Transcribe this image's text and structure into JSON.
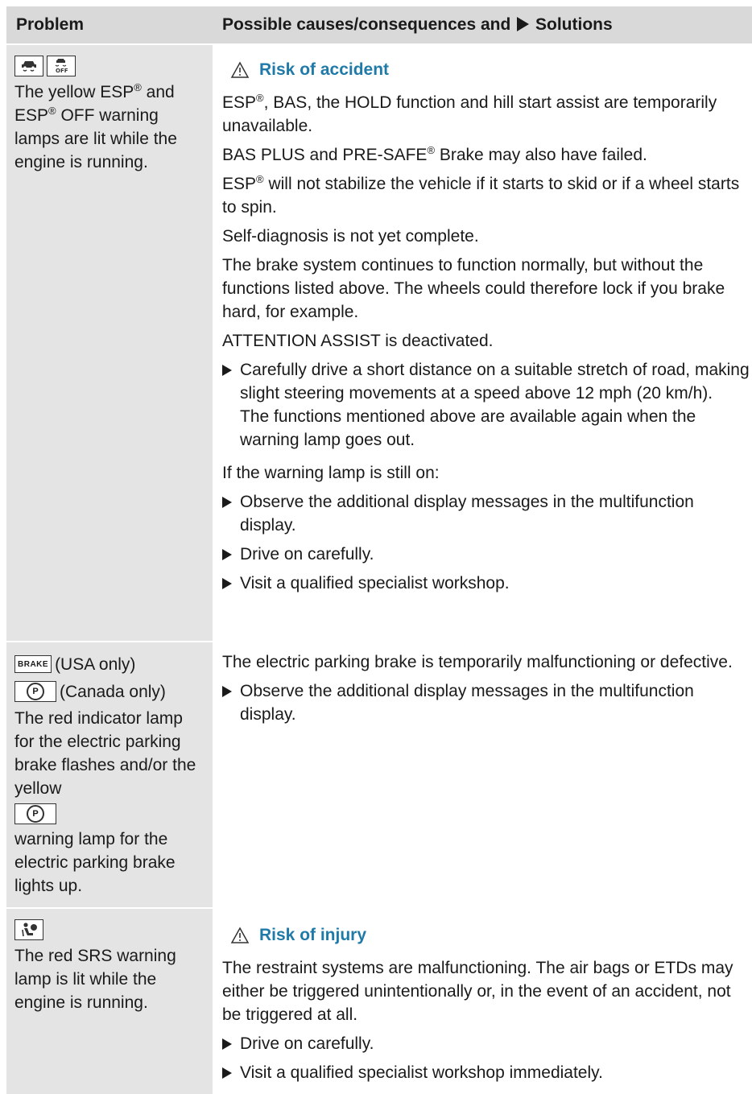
{
  "header": {
    "problem": "Problem",
    "solutions_pre": "Possible causes/consequences and",
    "solutions_post": "Solutions"
  },
  "rows": [
    {
      "icons": [
        "esp-warning-icon",
        "esp-off-warning-icon"
      ],
      "problem_text_a": "The yellow ESP",
      "problem_text_b": " and ESP",
      "problem_text_c": " OFF warning lamps are lit while the engine is running.",
      "reg": "®",
      "warning_title": "Risk of accident",
      "p1_a": "ESP",
      "p1_b": ", BAS, the HOLD function and hill start assist are temporarily unavailable.",
      "p2_a": "BAS PLUS and PRE-SAFE",
      "p2_b": " Brake may also have failed.",
      "p3_a": "ESP",
      "p3_b": " will not stabilize the vehicle if it starts to skid or if a wheel starts to spin.",
      "p4": "Self-diagnosis is not yet complete.",
      "p5": "The brake system continues to function normally, but without the functions listed above. The wheels could therefore lock if you brake hard, for example.",
      "p6": "ATTENTION ASSIST is deactivated.",
      "b1": "Carefully drive a short distance on a suitable stretch of road, making slight steering movements at a speed above 12 mph (20 km/h).",
      "b1_note": "The functions mentioned above are available again when the warning lamp goes out.",
      "p7": "If the warning lamp is still on:",
      "b2": "Observe the additional display messages in the multifunction display.",
      "b3": "Drive on carefully.",
      "b4": "Visit a qualified specialist workshop."
    },
    {
      "brake_label": "BRAKE",
      "usa_only": "(USA only)",
      "canada_only": "(Canada only)",
      "p_symbol": "P",
      "problem_text_a": "The red indicator lamp for the electric parking brake flashes and/or the yellow",
      "problem_text_b": "warning lamp for the electric parking brake lights up.",
      "p1": "The electric parking brake is temporarily malfunctioning or defective.",
      "b1": "Observe the additional display messages in the multifunction display."
    },
    {
      "icon": "srs-warning-icon",
      "problem_text": "The red SRS warning lamp is lit while the engine is running.",
      "warning_title": "Risk of injury",
      "p1": "The restraint systems are malfunctioning. The air bags or ETDs may either be triggered unintentionally or, in the event of an accident, not be triggered at all.",
      "b1": "Drive on carefully.",
      "b2": "Visit a qualified specialist workshop immediately."
    }
  ],
  "colors": {
    "warning_blue": "#1f7aa8",
    "header_bg": "#d9d9d9",
    "problem_bg": "#e4e4e4"
  }
}
